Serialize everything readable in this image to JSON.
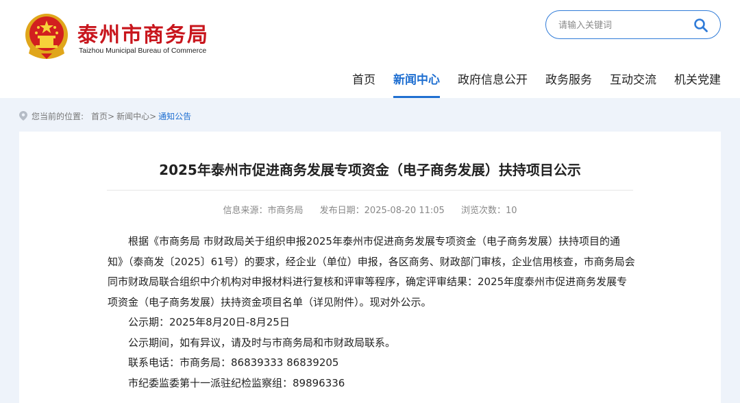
{
  "header": {
    "site_name": "泰州市商务局",
    "site_name_en": "Taizhou Municipal Bureau of Commerce",
    "emblem_icon": "national-emblem-icon"
  },
  "search": {
    "placeholder": "请输入关键词",
    "icon": "search-icon",
    "accent": "#2f7bd8"
  },
  "nav": {
    "items": [
      {
        "label": "首页",
        "active": false
      },
      {
        "label": "新闻中心",
        "active": true
      },
      {
        "label": "政府信息公开",
        "active": false
      },
      {
        "label": "政务服务",
        "active": false
      },
      {
        "label": "互动交流",
        "active": false
      },
      {
        "label": "机关党建",
        "active": false
      }
    ]
  },
  "breadcrumb": {
    "prefix": "您当前的位置:",
    "items": [
      "首页>",
      "新闻中心>",
      "通知公告"
    ]
  },
  "article": {
    "title": "2025年泰州市促进商务发展专项资金（电子商务发展）扶持项目公示",
    "meta": {
      "source": "信息来源：市商务局",
      "date": "发布日期：2025-08-20 11:05",
      "views": "浏览次数：10"
    },
    "paragraph": "根据《市商务局 市财政局关于组织申报2025年泰州市促进商务发展专项资金（电子商务发展）扶持项目的通知》（泰商发〔2025〕61号）的要求，经企业（单位）申报，各区商务、财政部门审核，企业信用核查，市商务局会同市财政局联合组织中介机构对申报材料进行复核和评审等程序，确定评审结果：2025年度泰州市促进商务发展专项资金（电子商务发展）扶持资金项目名单（详见附件）。现对外公示。",
    "lines": [
      "公示期：2025年8月20日-8月25日",
      "公示期间，如有异议，请及时与市商务局和市财政局联系。",
      "联系电话：市商务局：86839333  86839205",
      "市纪委监委第十一派驻纪检监察组：89896336"
    ]
  },
  "colors": {
    "brand_red": "#c8161d",
    "nav_active": "#1f6fd1",
    "page_bg": "#eef3fa"
  }
}
